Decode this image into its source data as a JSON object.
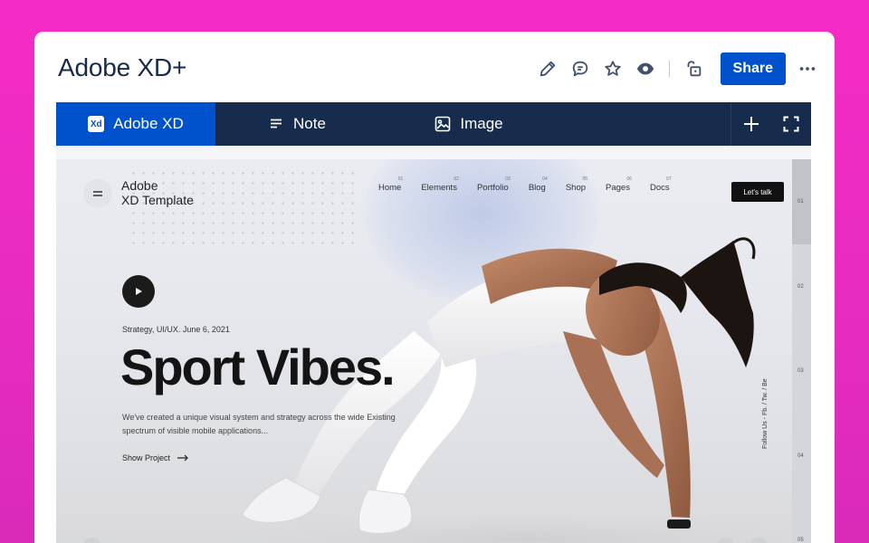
{
  "page": {
    "title": "Adobe XD+"
  },
  "header": {
    "share_label": "Share",
    "icons": [
      "edit-icon",
      "comment-icon",
      "star-icon",
      "watch-icon",
      "restrictions-icon",
      "more-icon"
    ]
  },
  "tabs": [
    {
      "label": "Adobe XD",
      "icon": "xd-logo-icon",
      "active": true,
      "logo_text": "Xd"
    },
    {
      "label": "Note",
      "icon": "note-icon",
      "active": false
    },
    {
      "label": "Image",
      "icon": "image-icon",
      "active": false
    }
  ],
  "colors": {
    "accent": "#0052cc",
    "tabbar": "#172b4d",
    "background": "#f52bc6",
    "title": "#172b4d"
  },
  "preview": {
    "brand_line1": "Adobe",
    "brand_line2": "XD Template",
    "nav": [
      {
        "label": "Home",
        "num": "01"
      },
      {
        "label": "Elements",
        "num": "02"
      },
      {
        "label": "Portfolio",
        "num": "03"
      },
      {
        "label": "Blog",
        "num": "04"
      },
      {
        "label": "Shop",
        "num": "05"
      },
      {
        "label": "Pages",
        "num": "06"
      },
      {
        "label": "Docs",
        "num": "07"
      }
    ],
    "cta": "Let's talk",
    "meta": "Strategy, UI/UX.   June 6, 2021",
    "hero_title": "Sport Vibes.",
    "description": "We've created a unique visual system and strategy across the wide Existing spectrum of visible mobile applications...",
    "show_project": "Show Project",
    "social": "Follow Us  -  Fb.  /  Tw.  /  Be",
    "rail": [
      "01",
      "02",
      "03",
      "04",
      "05"
    ]
  }
}
